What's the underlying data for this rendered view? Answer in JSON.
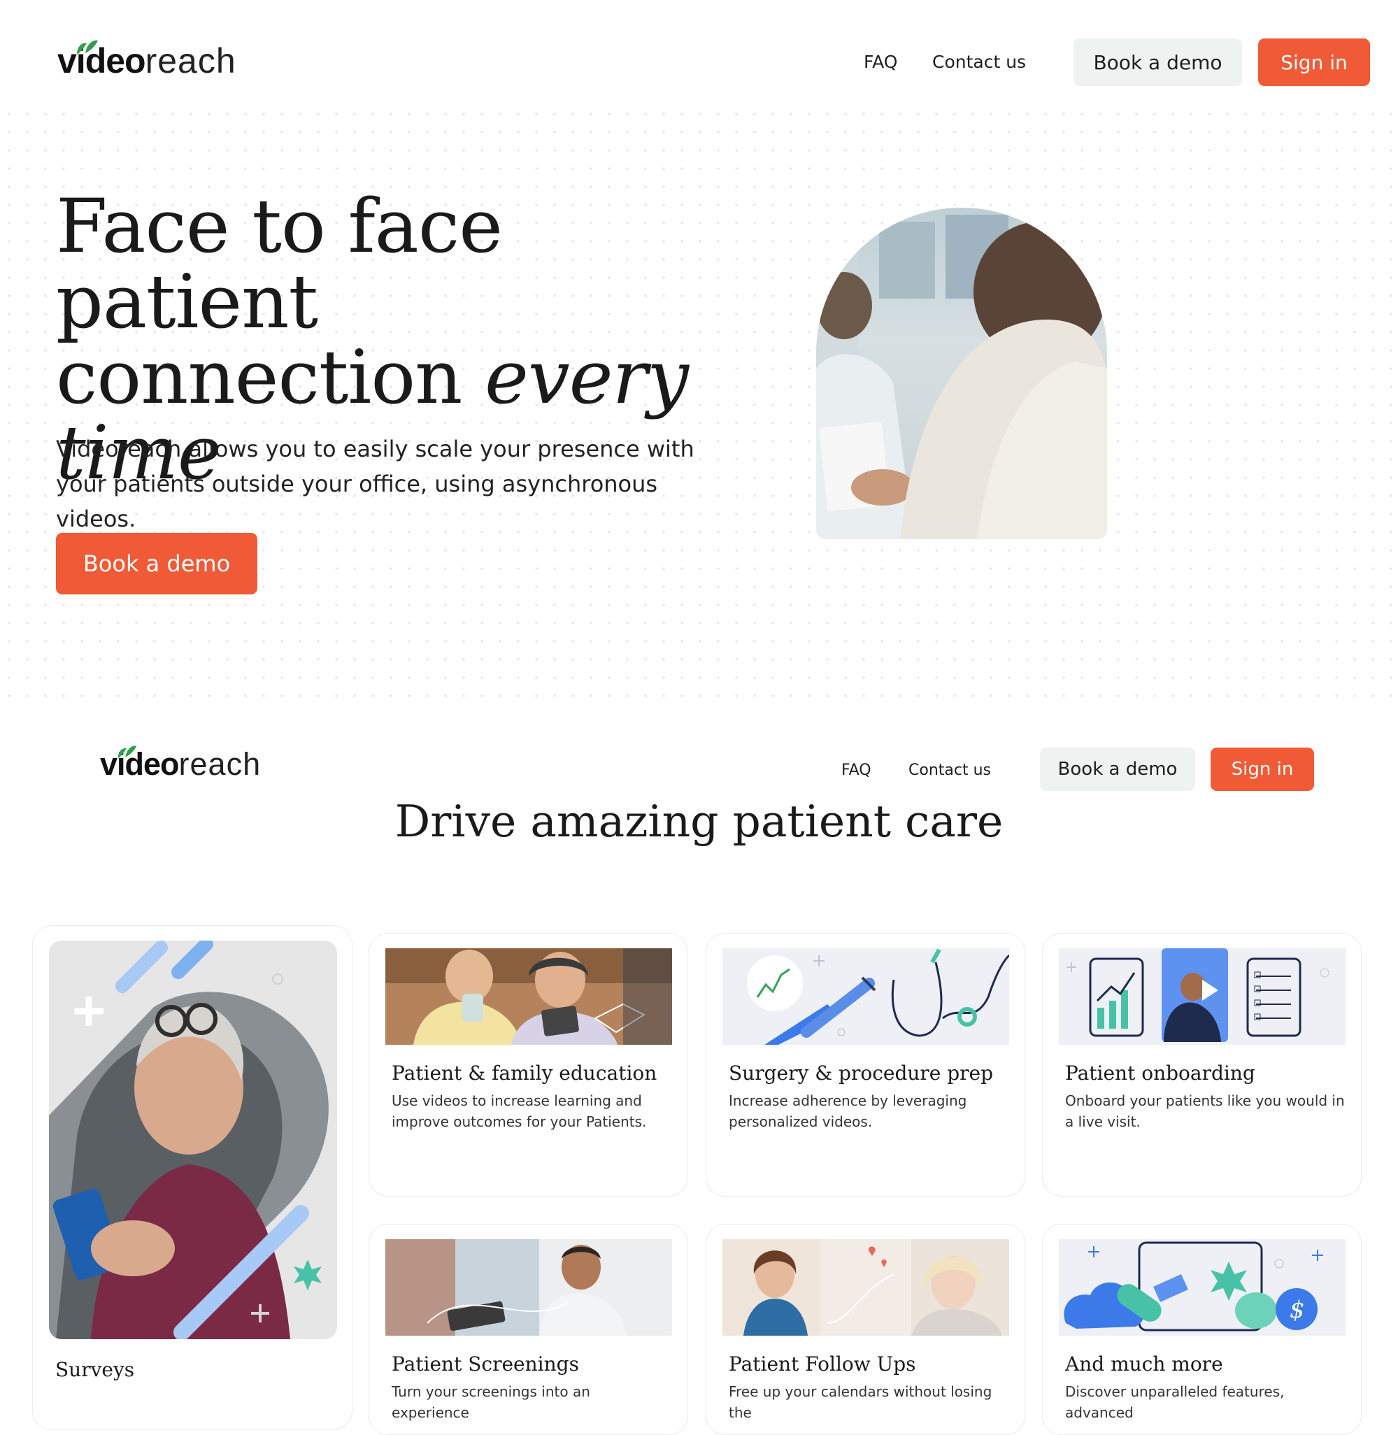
{
  "header": {
    "logo_bold": "video",
    "logo_light": "reach",
    "nav": {
      "faq": "FAQ",
      "contact": "Contact us"
    },
    "book_demo": "Book a demo",
    "sign_in": "Sign in"
  },
  "hero": {
    "title_line1": "Face to face patient",
    "title_line2": "connection ",
    "title_italic_1": "every",
    "title_italic_2": "time",
    "subtitle": "Videoreach allows you to easily scale your presence with your patients outside your office, using asynchronous videos.",
    "cta": "Book a demo"
  },
  "header2": {
    "logo_bold": "video",
    "logo_light": "reach",
    "nav": {
      "faq": "FAQ",
      "contact": "Contact us"
    },
    "book_demo": "Book a demo",
    "sign_in": "Sign in"
  },
  "section": {
    "heading": "Drive amazing patient care",
    "feature_card": {
      "title": "Surveys"
    },
    "cards": [
      {
        "title": "Patient & family education",
        "desc": "Use videos to increase learning and improve outcomes for your Patients."
      },
      {
        "title": "Surgery & procedure prep",
        "desc": "Increase adherence by leveraging personalized videos."
      },
      {
        "title": "Patient onboarding",
        "desc": "Onboard your patients like you would in a live visit."
      },
      {
        "title": "Patient Screenings",
        "desc": "Turn your screenings into an experience"
      },
      {
        "title": "Patient Follow Ups",
        "desc": "Free up your calendars without losing the"
      },
      {
        "title": "And much more",
        "desc": "Discover unparalleled features, advanced"
      }
    ]
  },
  "colors": {
    "brand_orange": "#f05a36",
    "ghost_button": "#eef3f2",
    "leaf_green": "#2e9e4e",
    "illustration_blue": "#3b7ae8",
    "illustration_teal": "#47c2a7"
  },
  "icons": [
    "leaf-logo-icon",
    "play-icon",
    "chart-icon",
    "checklist-icon",
    "stethoscope-icon",
    "syringe-icon",
    "cloud-icon",
    "pill-icon",
    "dollar-icon"
  ]
}
